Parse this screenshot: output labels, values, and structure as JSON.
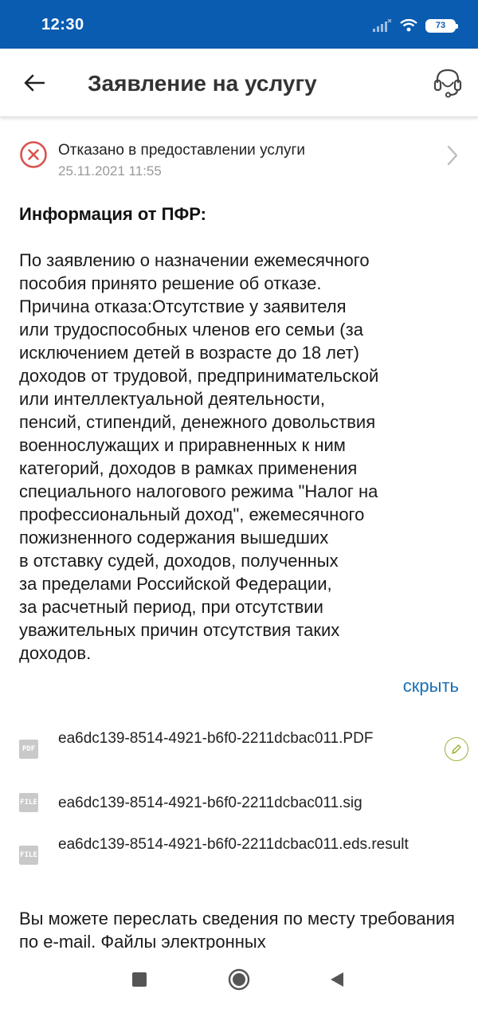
{
  "status_bar": {
    "time": "12:30",
    "battery": "73"
  },
  "app_bar": {
    "title": "Заявление на услугу"
  },
  "status": {
    "title": "Отказано в предоставлении услуги",
    "date": "25.11.2021 11:55",
    "color": "#d9534f"
  },
  "info": {
    "heading": "Информация от ПФР:",
    "body": "По заявлению о назначении ежемесячного\nпособия принято решение об отказе.\nПричина отказа:Отсутствие у заявителя\nили трудоспособных членов его семьи (за\nисключением детей в возрасте до 18 лет)\nдоходов от трудовой, предпринимательской\nили интеллектуальной деятельности,\nпенсий, стипендий, денежного довольствия\nвоеннослужащих и приравненных к ним\nкатегорий, доходов в рамках применения\nспециального налогового режима \"Налог на\nпрофессиональный доход\", ежемесячного\nпожизненного содержания вышедших\nв отставку судей, доходов, полученных\nза пределами Российской Федерации,\nза расчетный период, при отсутствии\nуважительных причин отсутствия таких\nдоходов.",
    "hide_label": "скрыть"
  },
  "files": [
    {
      "type_label": "PDF",
      "name": "ea6dc139-8514-4921-b6f0-2211dcbac011.PDF",
      "icon": "pdf-file-icon"
    },
    {
      "type_label": "FILE",
      "name": "ea6dc139-8514-4921-b6f0-2211dcbac011.sig",
      "icon": "file-icon"
    },
    {
      "type_label": "FILE",
      "name": "ea6dc139-8514-4921-b6f0-2211dcbac011.eds.result",
      "icon": "file-icon"
    }
  ],
  "footer": {
    "text": "Вы можете переслать сведения по месту требования по e-mail. Файлы электронных"
  },
  "colors": {
    "accent": "#0a5cb0",
    "link": "#1a6fb5",
    "sign": "#9ab33a"
  }
}
